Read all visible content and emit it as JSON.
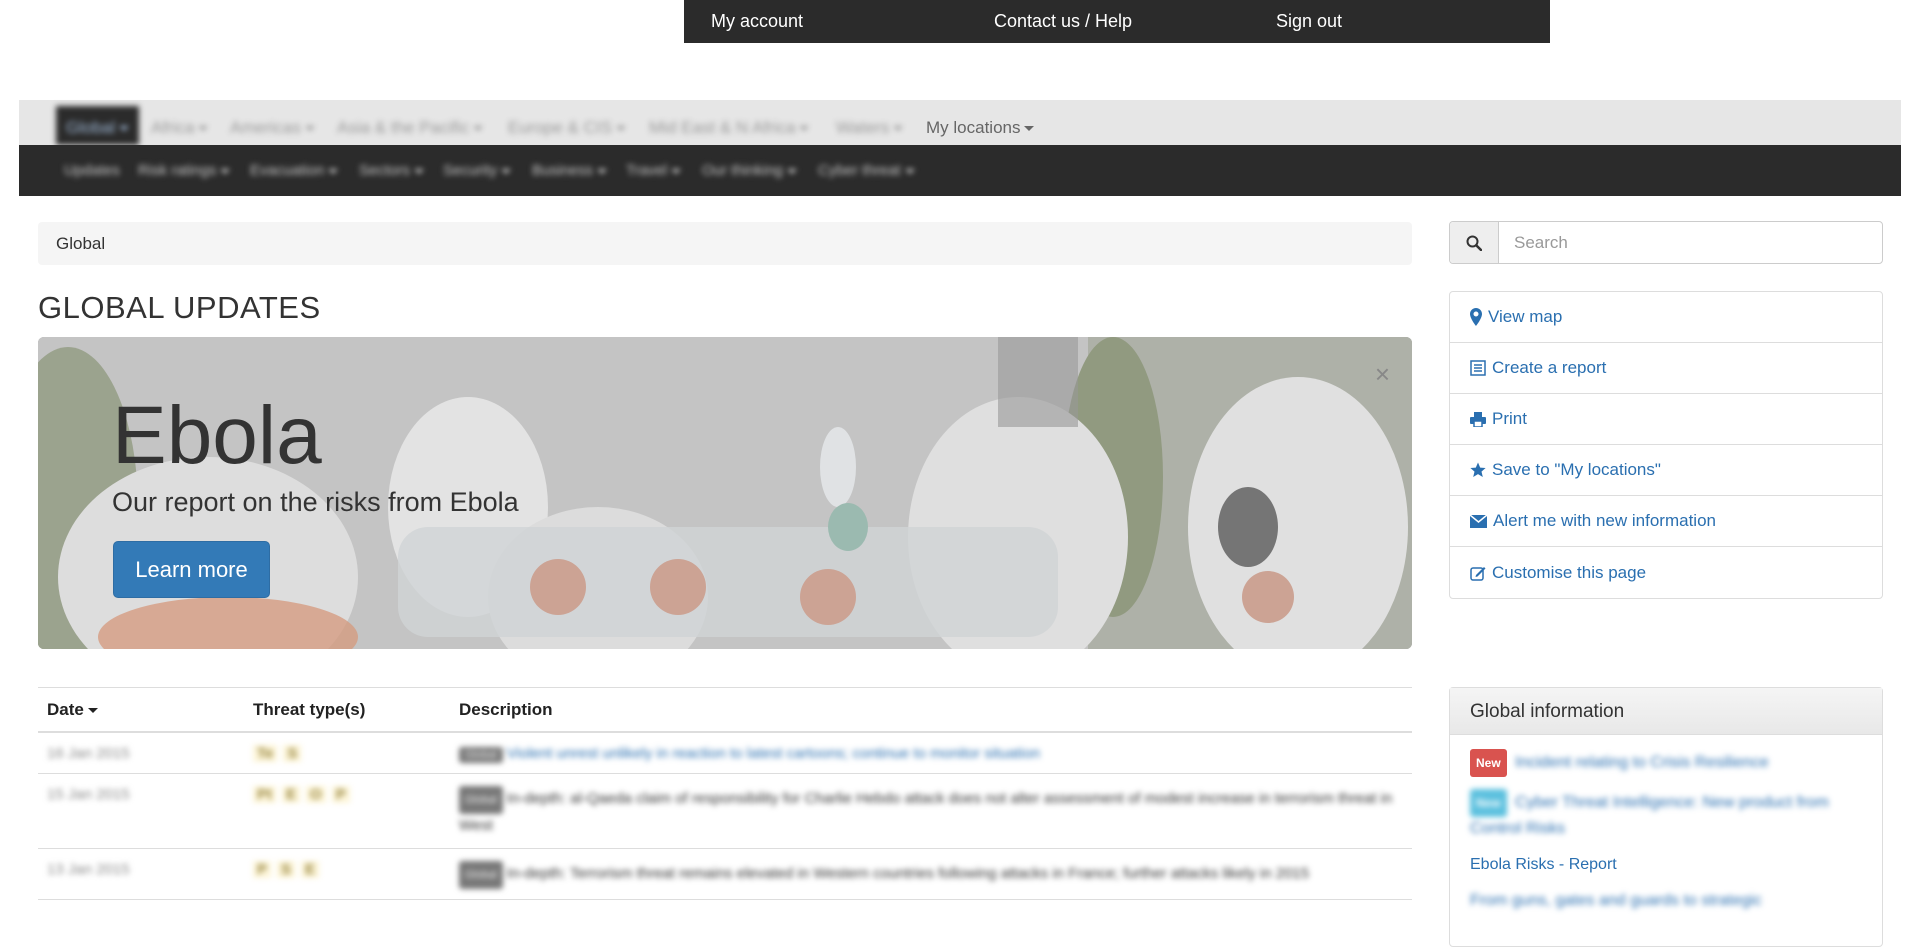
{
  "account_bar": {
    "my_account": "My account",
    "contact": "Contact us / Help",
    "sign_out": "Sign out"
  },
  "region_nav": {
    "items": [
      "Global",
      "Africa",
      "Americas",
      "Asia & the Pacific",
      "Europe & CIS",
      "Mid East & N Africa",
      "Waters"
    ],
    "my_locations": "My locations"
  },
  "topic_nav": {
    "items": [
      "Updates",
      "Risk ratings",
      "Evacuation",
      "Sectors",
      "Security",
      "Business",
      "Travel",
      "Our thinking",
      "Cyber threat"
    ]
  },
  "breadcrumb": {
    "current": "Global"
  },
  "search": {
    "placeholder": "Search"
  },
  "page_title": "GLOBAL UPDATES",
  "banner": {
    "headline": "Ebola",
    "subtitle": "Our report on the risks from Ebola",
    "cta": "Learn more",
    "close": "×"
  },
  "actions": {
    "view_map": "View map",
    "create_report": "Create a report",
    "print": "Print",
    "save": "Save to \"My locations\"",
    "alert": "Alert me with new information",
    "customise": "Customise this page"
  },
  "table": {
    "headers": {
      "date": "Date",
      "threat": "Threat type(s)",
      "description": "Description"
    },
    "rows": [
      {
        "date": "16 Jan 2015",
        "threats": [
          "Te",
          "S"
        ],
        "tag": "Global",
        "text": "Violent unrest unlikely in reaction to latest cartoons; continue to monitor situation",
        "link": true
      },
      {
        "date": "15 Jan 2015",
        "threats": [
          "Pt",
          "E",
          "O",
          "P"
        ],
        "tag": "Global",
        "text": "In-depth: al-Qaeda claim of responsibility for Charlie Hebdo attack does not alter assessment of modest increase in terrorism threat in West",
        "link": false
      },
      {
        "date": "13 Jan 2015",
        "threats": [
          "P",
          "S",
          "E"
        ],
        "tag": "Global",
        "text": "In-depth: Terrorism threat remains elevated in Western countries following attacks in France; further attacks likely in 2015",
        "link": false
      }
    ]
  },
  "global_info": {
    "heading": "Global information",
    "badge_new": "New",
    "badge_second": "New",
    "entry1": "Incident relating to Crisis Resilience",
    "entry2": "Cyber Threat Intelligence: New product from Control Risks",
    "entry3": "Ebola Risks - Report",
    "entry4": "From guns, gates and guards to strategic"
  },
  "colors": {
    "dark_bar": "#2b2b2b",
    "link": "#2a6fb0",
    "button": "#337ab7",
    "badge_new": "#d9534f"
  }
}
